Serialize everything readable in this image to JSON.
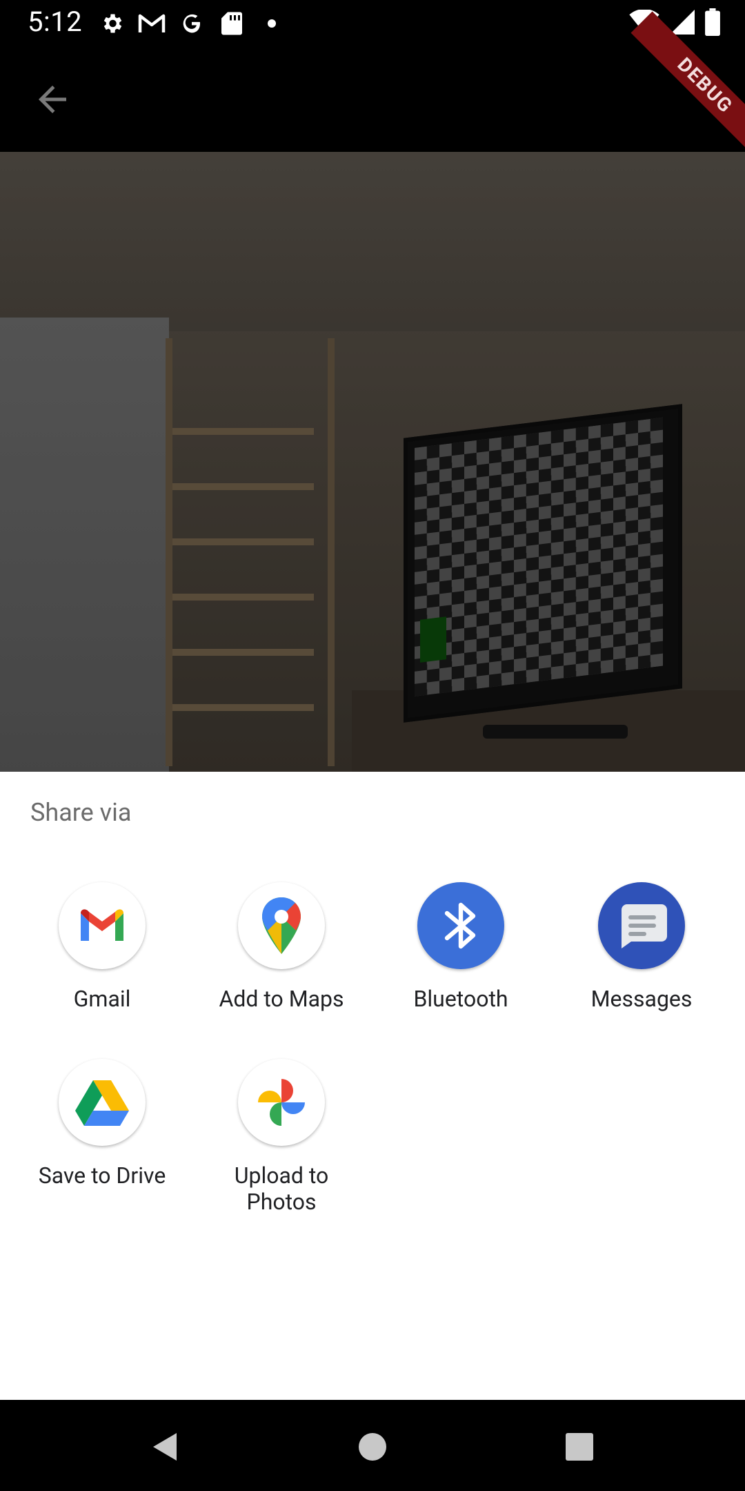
{
  "status_bar": {
    "time": "5:12",
    "left_icons": [
      "gear-icon",
      "gmail-m-icon",
      "google-g-icon",
      "sd-card-icon",
      "dot-icon"
    ],
    "right_icons": [
      "wifi-icon",
      "signal-icon",
      "battery-icon"
    ]
  },
  "app_bar": {
    "debug_banner": "DEBUG"
  },
  "share_sheet": {
    "title": "Share via",
    "targets": [
      {
        "label": "Gmail",
        "icon": "gmail-icon"
      },
      {
        "label": "Add to Maps",
        "icon": "maps-icon"
      },
      {
        "label": "Bluetooth",
        "icon": "bluetooth-icon"
      },
      {
        "label": "Messages",
        "icon": "messages-icon"
      },
      {
        "label": "Save to Drive",
        "icon": "drive-icon"
      },
      {
        "label": "Upload to\nPhotos",
        "icon": "photos-icon"
      }
    ]
  },
  "colors": {
    "bluetooth_bg": "#3b6fd8",
    "messages_bg": "#2f52b8"
  }
}
